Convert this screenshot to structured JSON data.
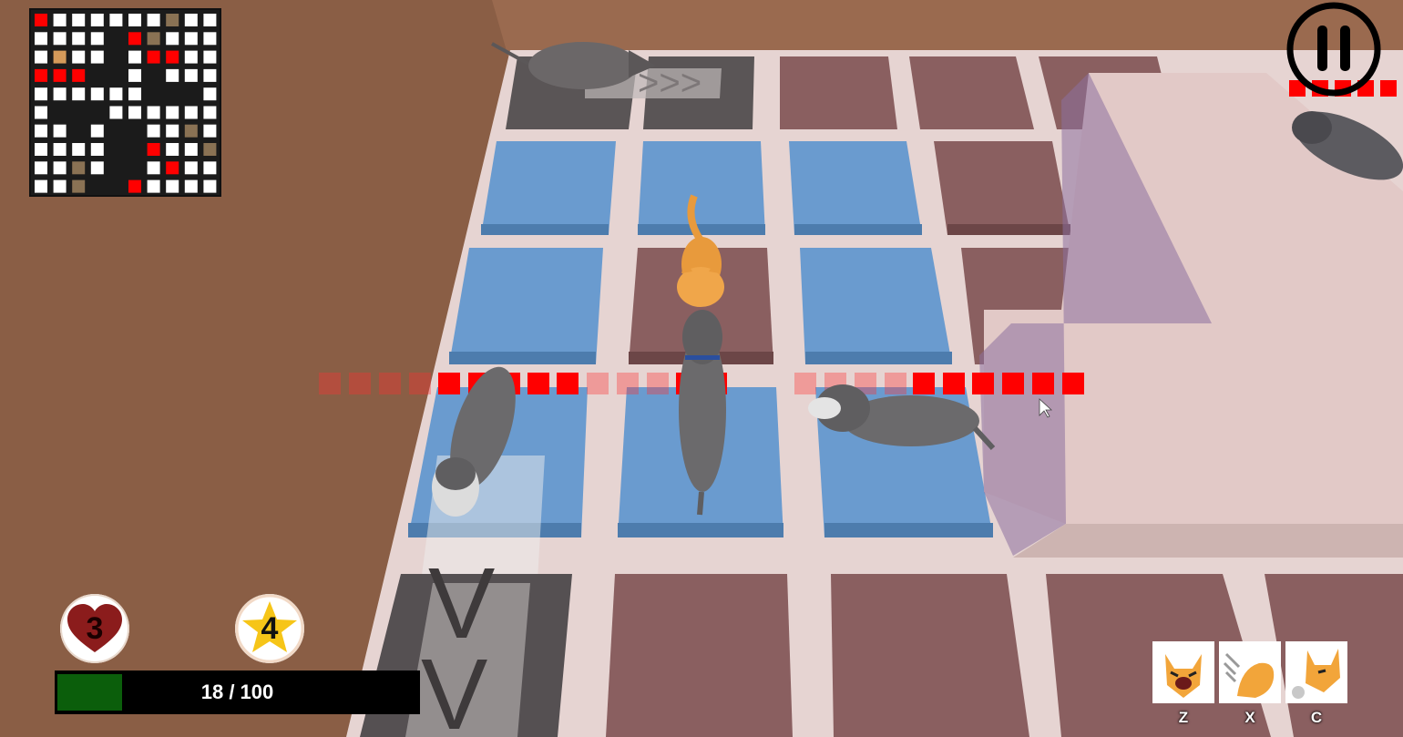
{
  "hud": {
    "lives": "3",
    "stars": "4",
    "progress": {
      "current": 18,
      "max": 100,
      "label": "18 / 100"
    },
    "skills": [
      {
        "key": "Z",
        "icon": "cat-hiss-icon"
      },
      {
        "key": "X",
        "icon": "cat-scratch-icon"
      },
      {
        "key": "C",
        "icon": "cat-spit-icon"
      }
    ]
  },
  "colors": {
    "floor": "#e6d4d2",
    "blue_tile": "#6a9bcf",
    "maroon_tile": "#8a5f60",
    "danger": "#ff0000",
    "health_fill": "#0b5e0b",
    "heart": "#8b1c1c",
    "star": "#f6c518"
  },
  "minimap": {
    "rows": [
      "RWWWWWWBWW",
      "WWWWDRBWWW",
      "WOWWDWRRWW",
      "RRRDDWDWWW",
      "WWWWWWDDDW",
      "WDDDWWWWWW",
      "WWDWDDWWBW",
      "WWWWDDRWWB",
      "WWBWDDWRWW",
      "WWBDDRWWWW"
    ]
  }
}
